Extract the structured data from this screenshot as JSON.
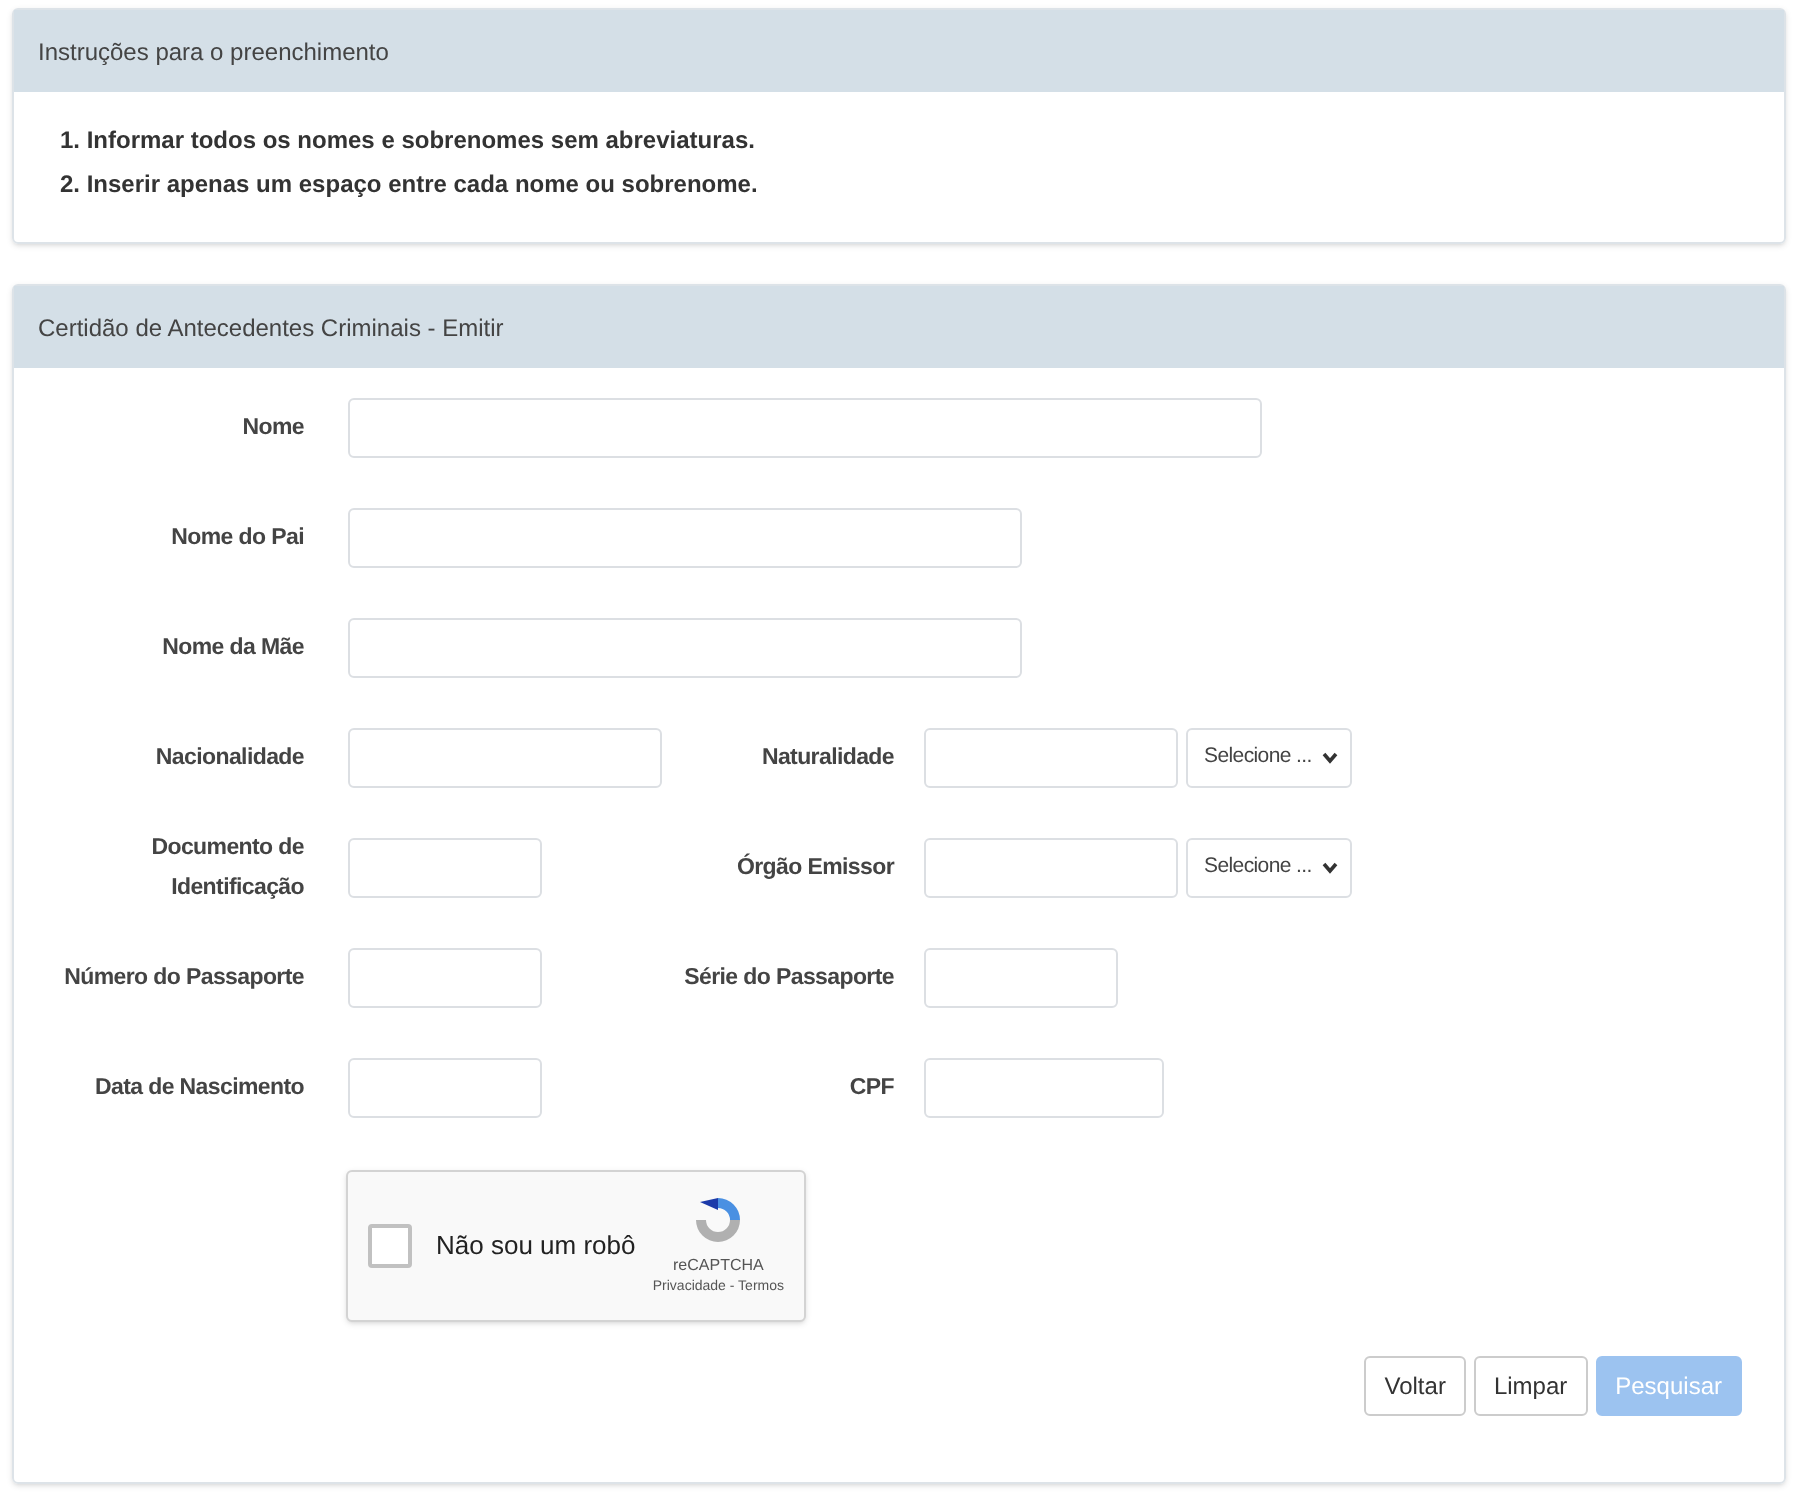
{
  "instructions": {
    "title": "Instruções para o preenchimento",
    "items": [
      "1. Informar todos os nomes e sobrenomes sem abreviaturas.",
      "2. Inserir apenas um espaço entre cada nome ou sobrenome."
    ]
  },
  "form": {
    "title": "Certidão de Antecedentes Criminais - Emitir",
    "rows": [
      {
        "fields": [
          {
            "label": "Nome"
          }
        ]
      },
      {
        "fields": [
          {
            "label": "Nome do Pai"
          }
        ]
      },
      {
        "fields": [
          {
            "label": "Nome da Mãe"
          }
        ]
      },
      {
        "fields": [
          {
            "label": "Nacionalidade"
          },
          {
            "label": "Naturalidade",
            "select": "Selecione ..."
          }
        ]
      },
      {
        "fields": [
          {
            "label": "Documento de Identificação"
          },
          {
            "label": "Órgão Emissor",
            "select": "Selecione ..."
          }
        ]
      },
      {
        "fields": [
          {
            "label": "Número do Passaporte"
          },
          {
            "label": "Série do Passaporte"
          }
        ]
      },
      {
        "fields": [
          {
            "label": "Data de Nascimento"
          },
          {
            "label": "CPF"
          }
        ]
      }
    ],
    "captcha": {
      "label": "Não sou um robô",
      "checked": false,
      "brand": "reCAPTCHA",
      "links": "Privacidade - Termos"
    },
    "buttons": [
      {
        "label": "Voltar",
        "kind": "default",
        "disabled": false
      },
      {
        "label": "Limpar",
        "kind": "default",
        "disabled": false
      },
      {
        "label": "Pesquisar",
        "kind": "primary",
        "disabled": true
      }
    ]
  }
}
